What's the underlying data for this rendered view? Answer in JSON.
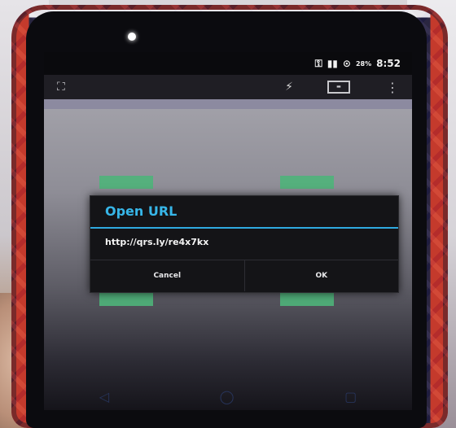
{
  "status_bar": {
    "battery_percent": "28%",
    "time": "8:52",
    "icons": [
      "key-icon",
      "signal-icon",
      "alarm-icon"
    ]
  },
  "camera_toolbar": {
    "icons": [
      "crop-frame-icon",
      "flash-icon",
      "hdr-icon",
      "overflow-menu-icon"
    ]
  },
  "dialog": {
    "title": "Open URL",
    "url": "http://qrs.ly/re4x7kx",
    "cancel_label": "Cancel",
    "ok_label": "OK",
    "accent_color": "#37b6e8"
  },
  "nav_bar": {
    "icons": [
      "back-icon",
      "home-icon",
      "recent-apps-icon"
    ]
  }
}
